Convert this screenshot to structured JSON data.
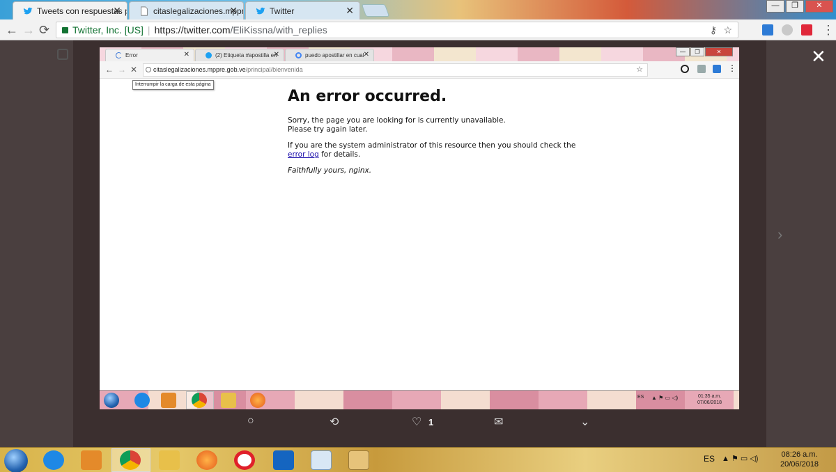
{
  "outer_browser": {
    "tabs": [
      {
        "title": "Tweets con respuestas p",
        "icon": "twitter-icon",
        "active": true
      },
      {
        "title": "citaslegalizaciones.mppr",
        "icon": "page-icon",
        "active": false
      },
      {
        "title": "Twitter",
        "icon": "twitter-icon",
        "active": false
      }
    ],
    "window_buttons": {
      "minimize": "—",
      "restore": "❐",
      "close": "✕"
    },
    "nav": {
      "back": "←",
      "forward": "→",
      "reload": "⟳"
    },
    "address": {
      "secure_label": "Twitter, Inc. [US]",
      "scheme_host": "https://twitter.com",
      "path": "/EliKissna/with_replies"
    },
    "key_icon": "⚷",
    "star_icon": "☆",
    "menu_icon": "⋮"
  },
  "modal": {
    "close": "✕",
    "next": "›"
  },
  "inner_screenshot": {
    "tabs": [
      {
        "title": "Error",
        "icon": "loading-icon"
      },
      {
        "title": "(2) Etiqueta #apostilla en",
        "icon": "twitter-icon"
      },
      {
        "title": "puedo apostillar en cual",
        "icon": "google-icon"
      }
    ],
    "nav": {
      "back": "←",
      "forward": "→",
      "stop": "✕"
    },
    "address": {
      "host": "citaslegalizaciones.mppre.gob.ve",
      "path": "/principal/bienvenida"
    },
    "tooltip": "Interrumpir la carga de esta página",
    "page": {
      "heading": "An error occurred.",
      "line1": "Sorry, the page you are looking for is currently unavailable.",
      "line2": "Please try again later.",
      "line3": "If you are the system administrator of this resource then you should check the",
      "link": "error log",
      "line4": " for details.",
      "signature": "Faithfully yours, nginx."
    },
    "tray": {
      "lang": "ES",
      "time": "01:35 a.m.",
      "date": "07/06/2018"
    }
  },
  "tweet_actions": {
    "reply": "○",
    "retweet": "⟲",
    "like": "♡",
    "like_count": "1",
    "message": "✉",
    "more": "⌄"
  },
  "taskbar": {
    "lang": "ES",
    "time": "08:26 a.m.",
    "date": "20/06/2018"
  },
  "colors": {
    "twitter_blue": "#1da1f2",
    "secure_green": "#137333",
    "link": "#1a0dab"
  }
}
